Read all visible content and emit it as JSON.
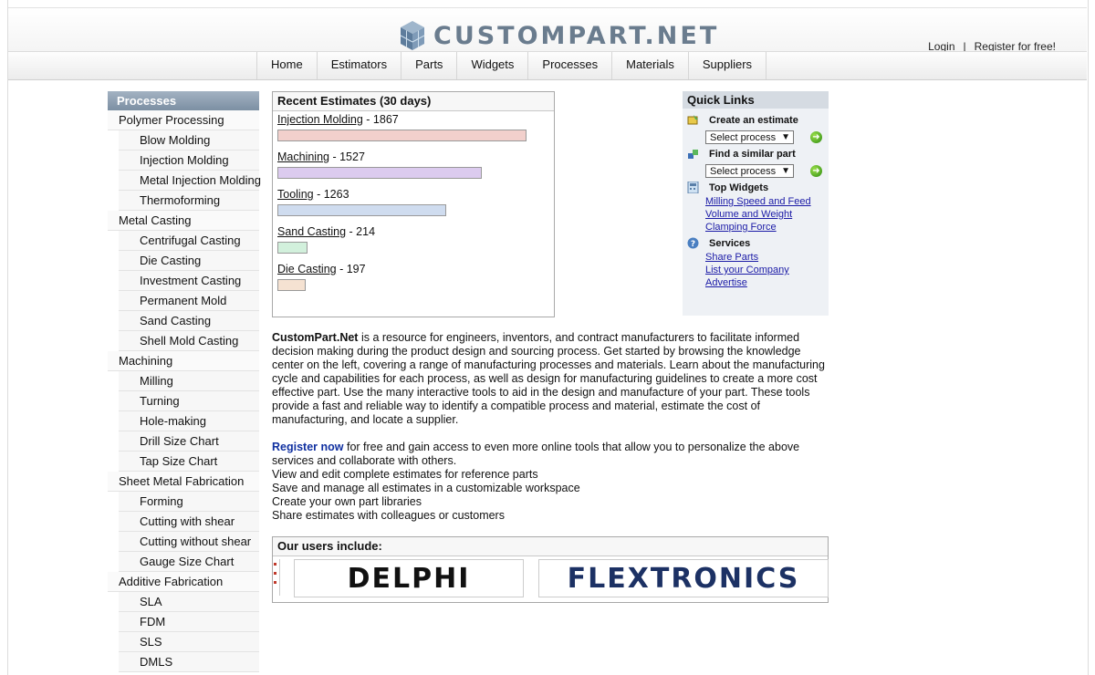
{
  "header": {
    "brand": "CUSTOMPART.NET",
    "login_label": "Login",
    "separator": "|",
    "register_label": "Register for free!"
  },
  "nav": {
    "items": [
      "Home",
      "Estimators",
      "Parts",
      "Widgets",
      "Processes",
      "Materials",
      "Suppliers"
    ]
  },
  "sidebar": {
    "title": "Processes",
    "items": [
      {
        "label": "Polymer Processing",
        "level": "category"
      },
      {
        "label": "Blow Molding",
        "level": "sub"
      },
      {
        "label": "Injection Molding",
        "level": "sub"
      },
      {
        "label": "Metal Injection Molding",
        "level": "sub"
      },
      {
        "label": "Thermoforming",
        "level": "sub"
      },
      {
        "label": "Metal Casting",
        "level": "category"
      },
      {
        "label": "Centrifugal Casting",
        "level": "sub"
      },
      {
        "label": "Die Casting",
        "level": "sub"
      },
      {
        "label": "Investment Casting",
        "level": "sub"
      },
      {
        "label": "Permanent Mold",
        "level": "sub"
      },
      {
        "label": "Sand Casting",
        "level": "sub"
      },
      {
        "label": "Shell Mold Casting",
        "level": "sub"
      },
      {
        "label": "Machining",
        "level": "category"
      },
      {
        "label": "Milling",
        "level": "sub"
      },
      {
        "label": "Turning",
        "level": "sub"
      },
      {
        "label": "Hole-making",
        "level": "sub"
      },
      {
        "label": "Drill Size Chart",
        "level": "sub"
      },
      {
        "label": "Tap Size Chart",
        "level": "sub"
      },
      {
        "label": "Sheet Metal Fabrication",
        "level": "category"
      },
      {
        "label": "Forming",
        "level": "sub"
      },
      {
        "label": "Cutting with shear",
        "level": "sub"
      },
      {
        "label": "Cutting without shear",
        "level": "sub"
      },
      {
        "label": "Gauge Size Chart",
        "level": "sub"
      },
      {
        "label": "Additive Fabrication",
        "level": "category"
      },
      {
        "label": "SLA",
        "level": "sub"
      },
      {
        "label": "FDM",
        "level": "sub"
      },
      {
        "label": "SLS",
        "level": "sub"
      },
      {
        "label": "DMLS",
        "level": "sub"
      }
    ]
  },
  "recent": {
    "title": "Recent Estimates (30 days)",
    "max_value": 1867,
    "estimates": [
      {
        "label": "Injection Molding",
        "count": "1867",
        "value": 1867,
        "color": "#f2d0cc"
      },
      {
        "label": "Machining",
        "count": "1527",
        "value": 1527,
        "color": "#dccbef"
      },
      {
        "label": "Tooling",
        "count": "1263",
        "value": 1263,
        "color": "#cfdcef"
      },
      {
        "label": "Sand Casting",
        "count": "214",
        "value": 214,
        "color": "#d2f0dc"
      },
      {
        "label": "Die Casting",
        "count": "197",
        "value": 197,
        "color": "#f5e2d2"
      }
    ]
  },
  "quick_links": {
    "title": "Quick Links",
    "create_label": "Create an estimate",
    "create_select": "Select process",
    "find_label": "Find a similar part",
    "find_select": "Select process",
    "widgets_label": "Top Widgets",
    "widgets": [
      "Milling Speed and Feed",
      "Volume and Weight",
      "Clamping Force"
    ],
    "services_label": "Services",
    "services": [
      "Share Parts",
      "List your Company",
      "Advertise"
    ]
  },
  "intro": {
    "brand": "CustomPart.Net",
    "text": " is a resource for engineers, inventors, and contract manufacturers to facilitate informed decision making during the product design and sourcing process. Get started by browsing the knowledge center on the left, covering a range of manufacturing processes and materials. Learn about the manufacturing cycle and capabilities for each process, as well as design for manufacturing guidelines to create a more cost effective part. Use the many interactive tools to aid in the design and manufacture of your part. These tools provide a fast and reliable way to identify a compatible process and material, estimate the cost of manufacturing, and locate a supplier.",
    "register_link": "Register now",
    "register_text": " for free and gain access to even more online tools that allow you to personalize the above services and collaborate with others.",
    "benefits": [
      "View and edit complete estimates for reference parts",
      "Save and manage all estimates in a customizable workspace",
      "Create your own part libraries",
      "Share estimates with colleagues or customers"
    ]
  },
  "users": {
    "title": "Our users include:",
    "logos": [
      "DELPHI",
      "FLEXTRONICS"
    ]
  }
}
